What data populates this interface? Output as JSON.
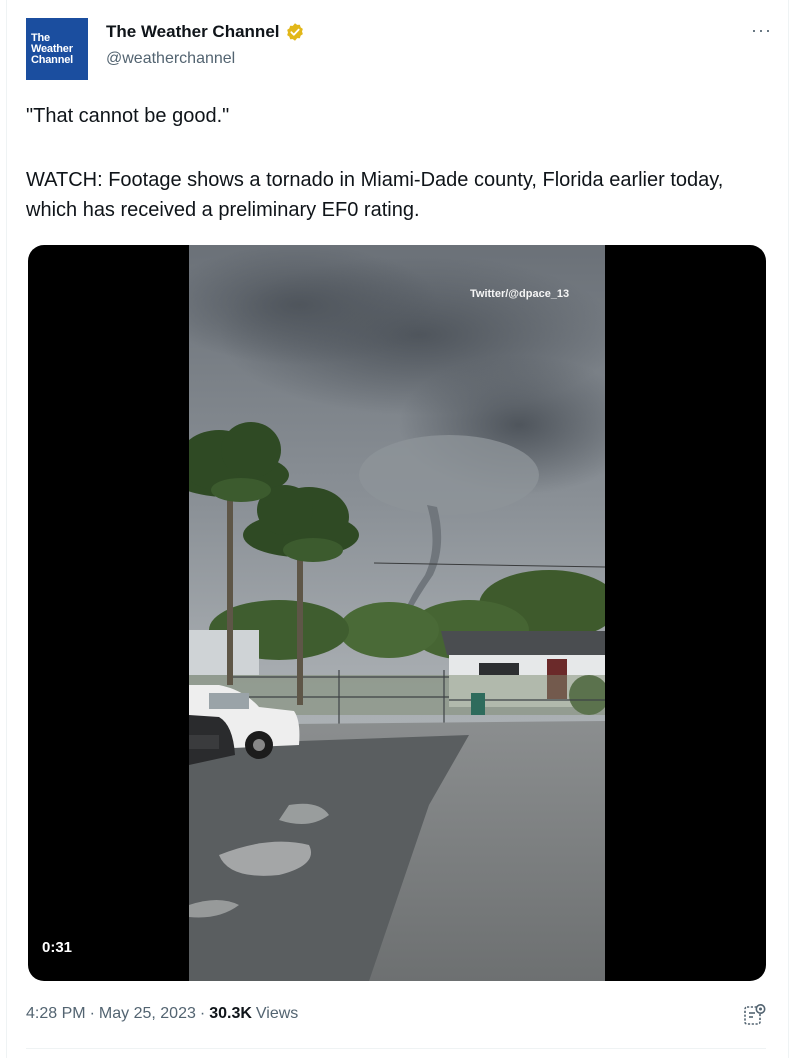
{
  "tweet": {
    "author": {
      "name": "The Weather Channel",
      "handle": "@weatherchannel",
      "avatar_lines": [
        "The",
        "Weather",
        "Channel"
      ],
      "avatar_color": "#1b4e9f",
      "verified_color": "#e2b719"
    },
    "more_label": "···",
    "text_line1": "\"That cannot be good.\"",
    "text_line2": "WATCH: Footage shows a tornado in Miami-Dade county, Florida earlier today, which has received a preliminary EF0 rating.",
    "media": {
      "credit": "Twitter/@dpace_13",
      "duration": "0:31"
    },
    "time": "4:28 PM",
    "separator": "·",
    "date": "May 25, 2023",
    "views_count": "30.3K",
    "views_label": "Views"
  },
  "icons": {
    "verified": "verified-badge-icon",
    "more": "more-options-icon",
    "analytics": "analytics-icon"
  }
}
